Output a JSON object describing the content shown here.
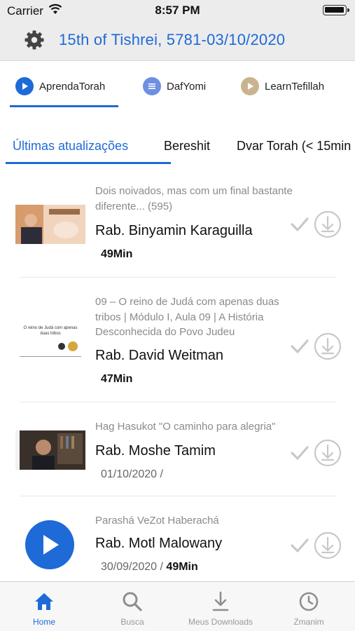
{
  "status_bar": {
    "carrier": "Carrier",
    "time": "8:57 PM"
  },
  "header": {
    "title": "15th of Tishrei, 5781-03/10/2020",
    "gear_icon": "gear-icon"
  },
  "category_tabs": [
    {
      "label": "AprendaTorah",
      "icon": "play-circle-icon",
      "icon_color": "#1e6ad6",
      "active": true
    },
    {
      "label": "DafYomi",
      "icon": "list-circle-icon",
      "icon_color": "#6f8fe0",
      "active": false
    },
    {
      "label": "LearnTefillah",
      "icon": "play-circle-icon",
      "icon_color": "#c9b48f",
      "active": false
    }
  ],
  "sub_tabs": [
    {
      "label": "Últimas atualizações",
      "active": true
    },
    {
      "label": "Bereshit",
      "active": false
    },
    {
      "label": "Dvar Torah (< 15min",
      "active": false
    }
  ],
  "lessons": [
    {
      "description": "Dois noivados, mas com um final bastante diferente... (595)",
      "rabbi": "Rab. Binyamin Karaguilla",
      "date": "",
      "duration": "49Min"
    },
    {
      "description": "09 – O reino de Judá com apenas duas tribos | Módulo I, Aula 09 | A História Desconhecida do Povo Judeu",
      "rabbi": "Rab. David Weitman",
      "date": "",
      "duration": "47Min",
      "thumb_text": "O reino de Judá com apenas duas tribos"
    },
    {
      "description": "Hag Hasukot \"O caminho para alegria\"",
      "rabbi": "Rab. Moshe Tamim",
      "date": "01/10/2020 /",
      "duration": ""
    },
    {
      "description": "Parashá VeZot Haberachá",
      "rabbi": "Rab. Motl Malowany",
      "date": "30/09/2020 /",
      "duration": "49Min"
    }
  ],
  "tab_bar": [
    {
      "label": "Home",
      "icon": "home-icon",
      "active": true
    },
    {
      "label": "Busca",
      "icon": "search-icon",
      "active": false
    },
    {
      "label": "Meus Downloads",
      "icon": "download-icon",
      "active": false
    },
    {
      "label": "Zmanim",
      "icon": "clock-icon",
      "active": false
    }
  ],
  "colors": {
    "accent": "#1e6ad6",
    "header_bg": "#ececec",
    "muted_text": "#8a8a8a",
    "icon_gray": "#c8c8c8"
  }
}
